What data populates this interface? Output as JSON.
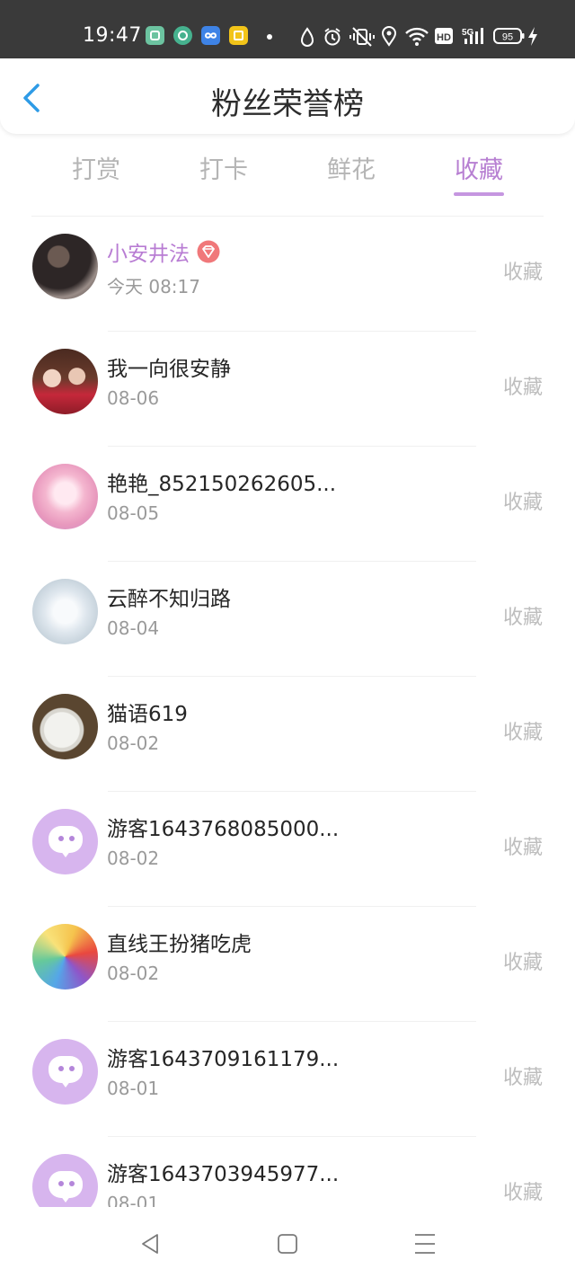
{
  "status_bar": {
    "time": "19:47",
    "battery": "95",
    "network": "5G",
    "hd": "HD",
    "app_icon_colors": [
      "#6cc3a0",
      "#46b28f",
      "#3e83e6",
      "#f2c419"
    ],
    "icons": [
      "water-drop-icon",
      "alarm-icon",
      "vibrate-icon",
      "location-icon",
      "wifi-icon",
      "hd-icon",
      "signal-icon",
      "battery-icon",
      "charging-icon"
    ]
  },
  "header": {
    "title": "粉丝荣誉榜",
    "back_icon": "chevron-left-icon"
  },
  "tabs": [
    {
      "label": "打赏",
      "active": false
    },
    {
      "label": "打卡",
      "active": false
    },
    {
      "label": "鲜花",
      "active": false
    },
    {
      "label": "收藏",
      "active": true
    }
  ],
  "list": [
    {
      "name": "小安井法",
      "time": "今天 08:17",
      "type": "收藏",
      "vip": true
    },
    {
      "name": "我一向很安静",
      "time": "08-06",
      "type": "收藏"
    },
    {
      "name": "艳艳_852150262605...",
      "time": "08-05",
      "type": "收藏"
    },
    {
      "name": "云醉不知归路",
      "time": "08-04",
      "type": "收藏"
    },
    {
      "name": "猫语619",
      "time": "08-02",
      "type": "收藏"
    },
    {
      "name": "游客1643768085000...",
      "time": "08-02",
      "type": "收藏",
      "guest": true
    },
    {
      "name": "直线王扮猪吃虎",
      "time": "08-02",
      "type": "收藏"
    },
    {
      "name": "游客1643709161179...",
      "time": "08-01",
      "type": "收藏",
      "guest": true
    },
    {
      "name": "游客1643703945977...",
      "time": "08-01",
      "type": "收藏",
      "guest": true
    }
  ],
  "colors": {
    "accent": "#b77fd2",
    "tab_underline": "#c596e0",
    "back_arrow": "#2e9be6",
    "vip_badge": "#f0787a",
    "status_bar_bg": "#3a3a3a"
  },
  "nav_bar": [
    "back-triangle-icon",
    "home-square-icon",
    "menu-lines-icon"
  ]
}
